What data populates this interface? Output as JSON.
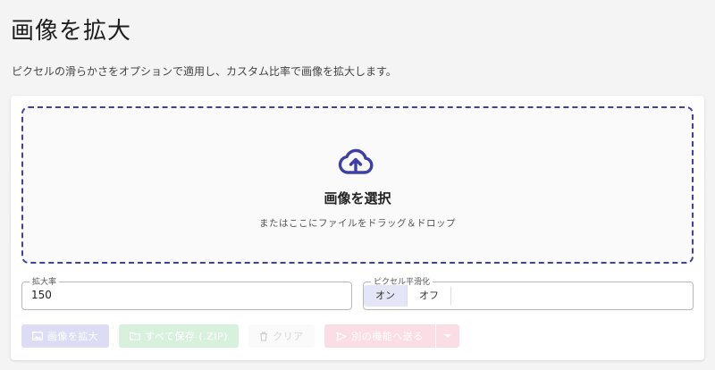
{
  "header": {
    "title": "画像を拡大",
    "subtitle": "ピクセルの滑らかさをオプションで適用し、カスタム比率で画像を拡大します。"
  },
  "dropzone": {
    "icon": "cloud-upload-icon",
    "title": "画像を選択",
    "hint": "またはここにファイルをドラッグ＆ドロップ"
  },
  "scale": {
    "label": "拡大率",
    "value": "150"
  },
  "smoothing": {
    "label": "ピクセル平滑化",
    "options": [
      "オン",
      "オフ"
    ],
    "selected": "オン"
  },
  "actions": {
    "upscale": {
      "label": "画像を拡大",
      "icon": "image-icon"
    },
    "save_all": {
      "label": "すべて保存 (.ZIP)",
      "icon": "folder-icon"
    },
    "clear": {
      "label": "クリア",
      "icon": "trash-icon"
    },
    "send": {
      "label": "別の機能へ送る",
      "icon": "send-icon"
    },
    "send_menu": {
      "icon": "chevron-down-icon"
    }
  },
  "colors": {
    "accent": "#3f3fa8",
    "upscale_button": "#dcdcf4",
    "save_button": "#d8f1dc",
    "send_button": "#fbdde6"
  }
}
